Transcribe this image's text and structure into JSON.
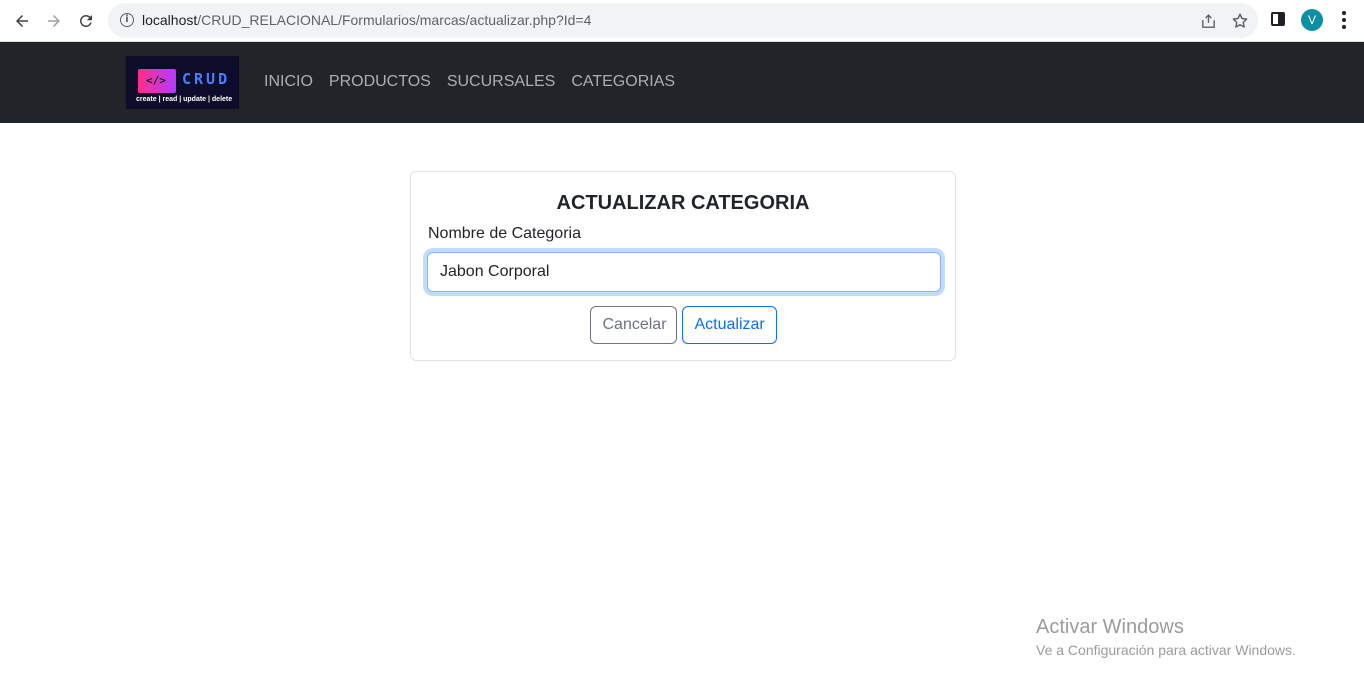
{
  "browser": {
    "url_host": "localhost",
    "url_path": "/CRUD_RELACIONAL/Formularios/marcas/actualizar.php?Id=4",
    "profile_initial": "V"
  },
  "navbar": {
    "logo": {
      "code_glyph": "</>",
      "title": "CRUD",
      "subtitle": "create | read | update | delete"
    },
    "links": [
      "INICIO",
      "PRODUCTOS",
      "SUCURSALES",
      "CATEGORIAS"
    ]
  },
  "form": {
    "title": "ACTUALIZAR CATEGORIA",
    "field_label": "Nombre de Categoria",
    "field_value": "Jabon Corporal",
    "cancel_label": "Cancelar",
    "submit_label": "Actualizar"
  },
  "watermark": {
    "title": "Activar Windows",
    "subtitle": "Ve a Configuración para activar Windows."
  }
}
